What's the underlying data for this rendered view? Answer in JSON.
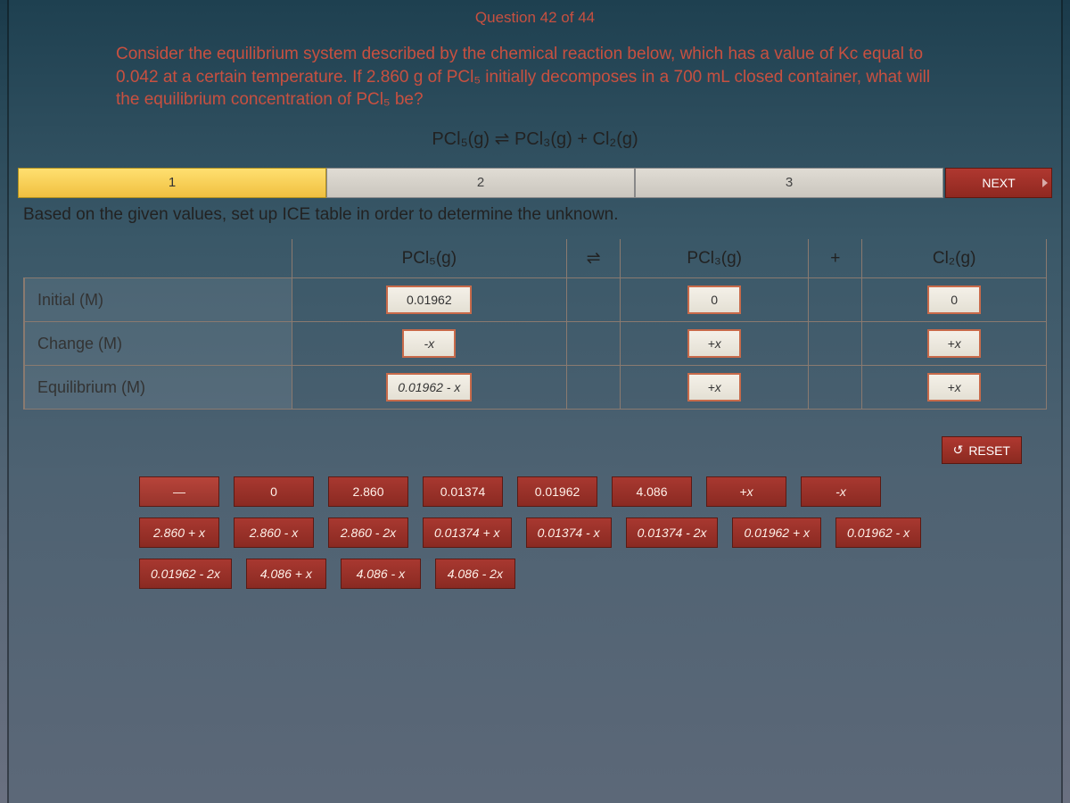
{
  "header": {
    "question_counter": "Question 42 of 44"
  },
  "prompt": {
    "text": "Consider the equilibrium system described by the chemical reaction below, which has a value of Kc equal to 0.042 at a certain temperature. If 2.860 g of PCl₅ initially decomposes in a 700 mL closed container, what will the equilibrium concentration of PCl₅ be?",
    "equation": "PCl₅(g) ⇌ PCl₃(g) + Cl₂(g)"
  },
  "steps": {
    "s1": "1",
    "s2": "2",
    "s3": "3",
    "next": "NEXT"
  },
  "instruction": "Based on the given values, set up ICE table in order to determine the unknown.",
  "ice": {
    "col1": "PCl₅(g)",
    "arrow": "⇌",
    "col2": "PCl₃(g)",
    "plus": "+",
    "col3": "Cl₂(g)",
    "rows": {
      "r1": {
        "label": "Initial (M)",
        "c1": "0.01962",
        "c2": "0",
        "c3": "0"
      },
      "r2": {
        "label": "Change (M)",
        "c1": "-x",
        "c2": "+x",
        "c3": "+x"
      },
      "r3": {
        "label": "Equilibrium (M)",
        "c1": "0.01962 - x",
        "c2": "+x",
        "c3": "+x"
      }
    }
  },
  "reset": "RESET",
  "tiles": [
    "—",
    "0",
    "2.860",
    "0.01374",
    "0.01962",
    "4.086",
    "+x",
    "-x",
    "2.860 + x",
    "2.860 - x",
    "2.860 - 2x",
    "0.01374 + x",
    "0.01374 - x",
    "0.01374 - 2x",
    "0.01962 + x",
    "0.01962 - x",
    "0.01962 - 2x",
    "4.086 + x",
    "4.086 - x",
    "4.086 - 2x"
  ]
}
